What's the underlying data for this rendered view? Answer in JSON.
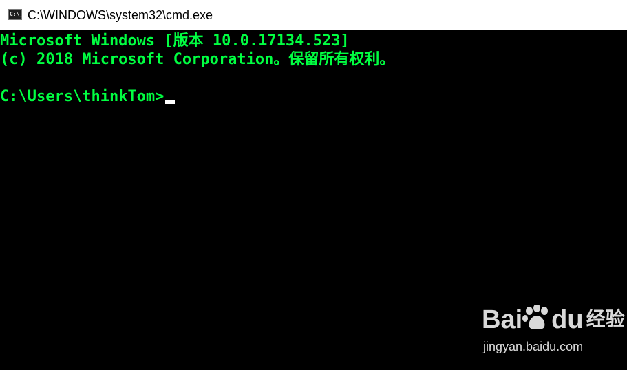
{
  "window": {
    "title": "C:\\WINDOWS\\system32\\cmd.exe",
    "icon": "cmd-icon",
    "icon_glyph": "C:\\_"
  },
  "console": {
    "text_color": "#00ff41",
    "background": "#000000",
    "lines": [
      "Microsoft Windows [版本 10.0.17134.523]",
      "(c) 2018 Microsoft Corporation。保留所有权利。",
      "C:\\Users\\thinkTom>"
    ]
  },
  "watermark": {
    "brand_left": "Bai",
    "brand_right": "du",
    "brand_cn": "经验",
    "url": "jingyan.baidu.com"
  }
}
